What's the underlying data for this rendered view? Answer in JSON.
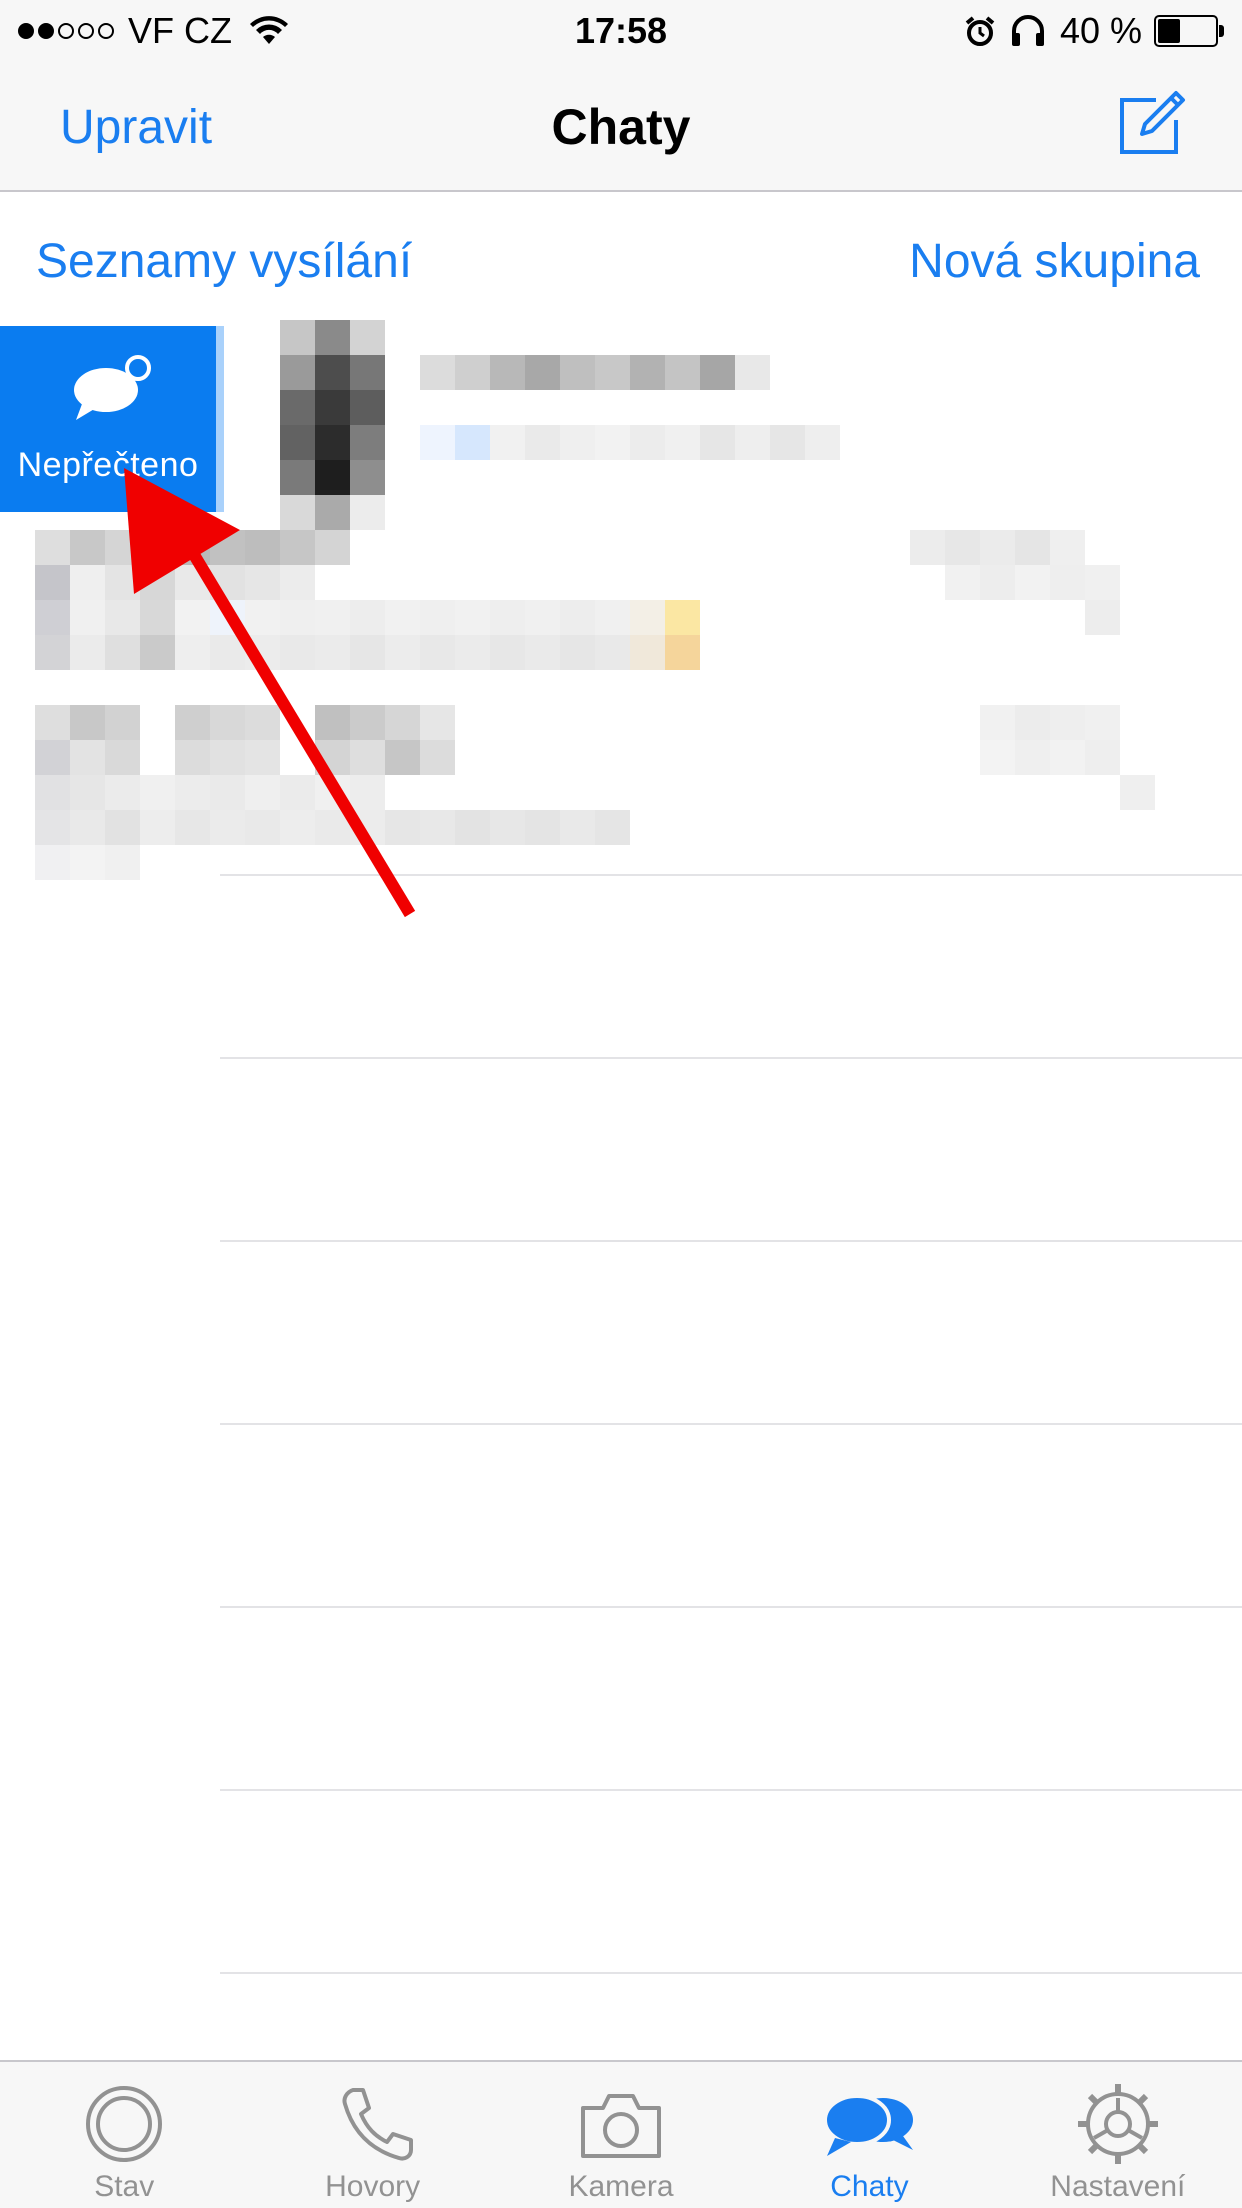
{
  "status_bar": {
    "carrier": "VF CZ",
    "time": "17:58",
    "battery": "40 %",
    "battery_level": 0.4,
    "signal_bars": 2,
    "signal_total": 5
  },
  "nav": {
    "edit_label": "Upravit",
    "title": "Chaty",
    "compose_icon": "compose-icon"
  },
  "links": {
    "broadcast_label": "Seznamy vysílání",
    "new_group_label": "Nová skupina"
  },
  "swipe_action": {
    "label": "Nepřečteno",
    "icon": "unread-bubble-icon",
    "color": "#0a7cf0"
  },
  "annotation": {
    "color": "#f00000"
  },
  "tabs": [
    {
      "label": "Stav",
      "icon": "status-icon",
      "active": false
    },
    {
      "label": "Hovory",
      "icon": "phone-icon",
      "active": false
    },
    {
      "label": "Kamera",
      "icon": "camera-icon",
      "active": false
    },
    {
      "label": "Chaty",
      "icon": "chats-icon",
      "active": true
    },
    {
      "label": "Nastavení",
      "icon": "gear-icon",
      "active": false
    }
  ],
  "colors": {
    "accent": "#1a7ef0",
    "inactive": "#929292"
  }
}
